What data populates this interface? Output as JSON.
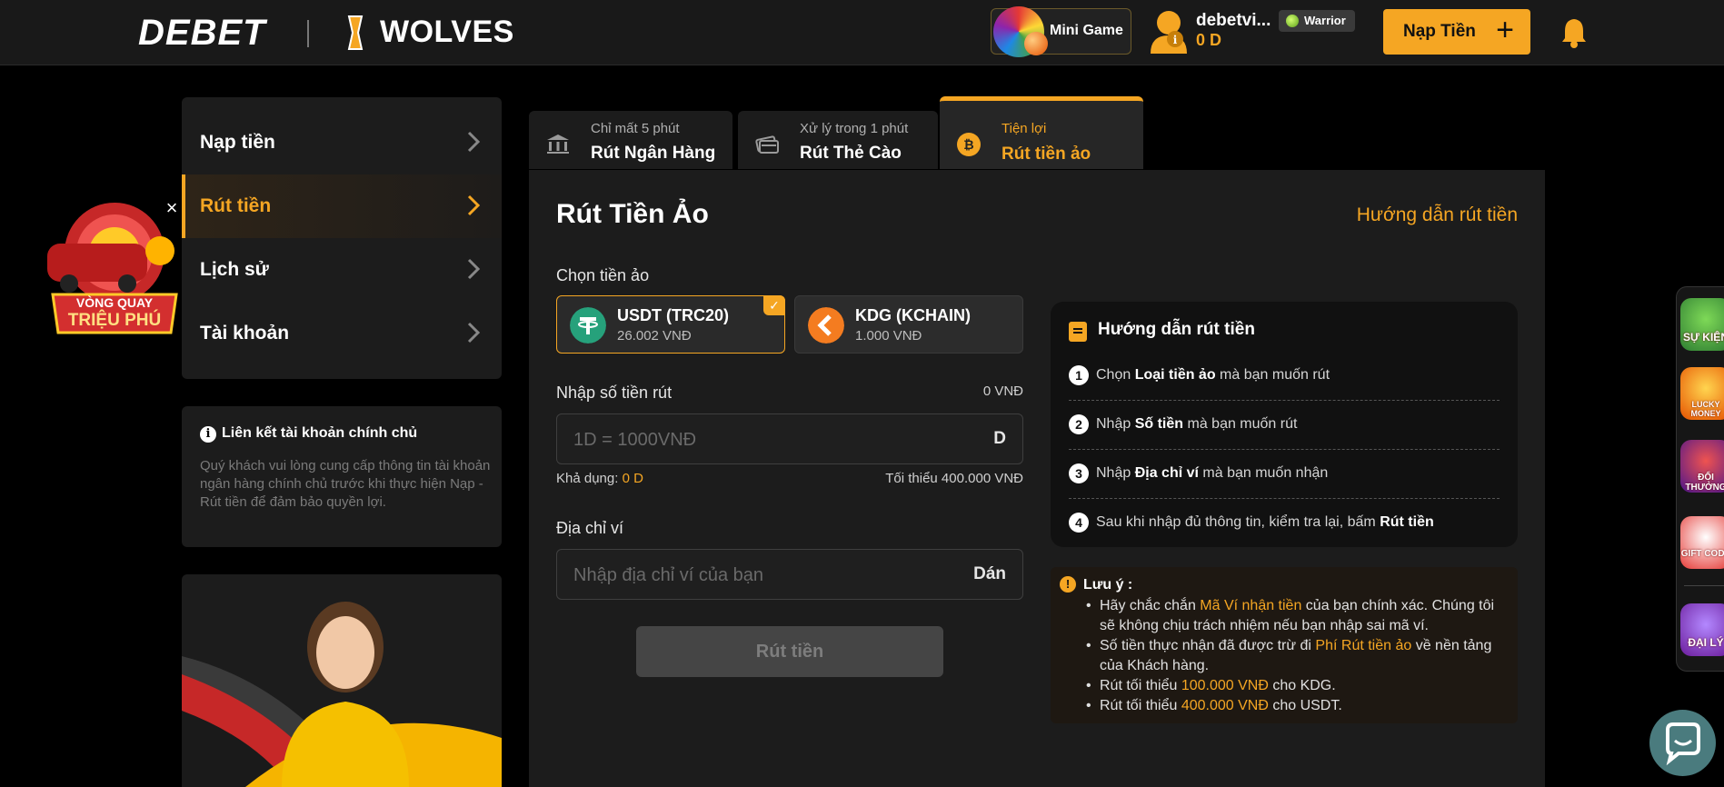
{
  "header": {
    "logo_primary": "DEBET",
    "logo_partner": "WOLVES",
    "minigame_label": "Mini Game",
    "username": "debetvi...",
    "balance": "0 D",
    "rank": "Warrior",
    "deposit_button": "Nạp Tiền",
    "deposit_plus": "+",
    "icons": [
      "minigame-wheel-icon",
      "user-avatar-icon",
      "bell-icon"
    ]
  },
  "sidebar": {
    "items": [
      {
        "label": "Nạp tiền"
      },
      {
        "label": "Rút tiền"
      },
      {
        "label": "Lịch sử"
      },
      {
        "label": "Tài khoản"
      }
    ],
    "info_title": "Liên kết tài khoản chính chủ",
    "info_text": "Quý khách vui lòng cung cấp thông tin tài khoản ngân hàng chính chủ trước khi thực hiện Nạp - Rút tiền để đảm bảo quyền lợi."
  },
  "floating_promo": {
    "label_top": "VÒNG QUAY",
    "label_bottom": "TRIỆU PHÚ",
    "close": "×"
  },
  "tabs": [
    {
      "sub": "Chỉ mất 5 phút",
      "title": "Rút Ngân Hàng"
    },
    {
      "sub": "Xử lý trong 1 phút",
      "title": "Rút Thẻ Cào"
    },
    {
      "sub": "Tiện lợi",
      "title": "Rút tiền ảo"
    }
  ],
  "main": {
    "title": "Rút Tiền Ảo",
    "guide_link": "Hướng dẫn rút tiền",
    "select_label": "Chọn tiền ảo",
    "coins": [
      {
        "name": "USDT (TRC20)",
        "price": "26.002 VNĐ",
        "color": "#26a17b"
      },
      {
        "name": "KDG (KCHAIN)",
        "price": "1.000 VNĐ",
        "color": "#f47c20"
      }
    ],
    "amount_label": "Nhập số tiền rút",
    "amount_converted": "0 VNĐ",
    "amount_placeholder": "1D = 1000VNĐ",
    "amount_suffix": "D",
    "available_label": "Khả dụng:",
    "available_value": "0 D",
    "minimum_text": "Tối thiểu 400.000 VNĐ",
    "wallet_label": "Địa chỉ ví",
    "wallet_placeholder": "Nhập địa chỉ ví của bạn",
    "wallet_paste": "Dán",
    "submit": "Rút tiền"
  },
  "guide": {
    "title": "Hướng dẫn rút tiền",
    "steps": [
      {
        "num": "1",
        "pre": "Chọn ",
        "bold": "Loại tiền ảo",
        "post": " mà bạn muốn rút"
      },
      {
        "num": "2",
        "pre": "Nhập ",
        "bold": "Số tiền",
        "post": " mà bạn muốn rút"
      },
      {
        "num": "3",
        "pre": "Nhập ",
        "bold": "Địa chỉ ví",
        "post": " mà bạn muốn nhận"
      },
      {
        "num": "4",
        "pre": "Sau khi nhập đủ thông tin, kiểm tra lại, bấm ",
        "bold": "Rút tiền",
        "post": ""
      }
    ]
  },
  "note": {
    "icon": "!",
    "title": "Lưu ý :",
    "item1_pre": "Hãy chắc chắn ",
    "item1_hl": "Mã Ví nhận tiền",
    "item1_post": " của bạn chính xác. Chúng tôi sẽ không chịu trách nhiệm nếu bạn nhập sai mã ví.",
    "item2_pre": "Số tiền thực nhận đã được trừ đi ",
    "item2_hl": "Phí Rút tiền ảo",
    "item2_post": " về nền tảng của Khách hàng.",
    "item3_pre": "Rút tối thiểu ",
    "item3_hl": "100.000 VNĐ",
    "item3_post": " cho KDG.",
    "item4_pre": "Rút tối thiểu ",
    "item4_hl": "400.000 VNĐ",
    "item4_post": " cho USDT."
  },
  "dock": [
    {
      "label": "SỰ KIỆN"
    },
    {
      "label": "LUCKY MONEY"
    },
    {
      "label": "ĐỔI THƯỞNG"
    },
    {
      "label": "GIFT CODE"
    },
    {
      "label": "ĐẠI LÝ"
    }
  ],
  "colors": {
    "accent": "#f5a623",
    "background": "#000000",
    "panel": "#1c1c1c"
  }
}
